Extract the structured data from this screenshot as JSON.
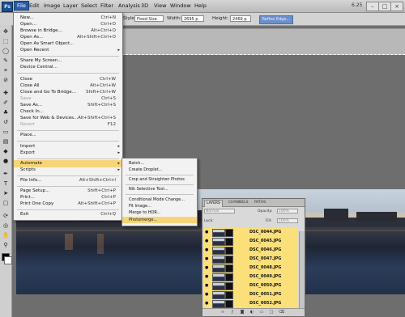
{
  "menubar": {
    "logo": "Ps",
    "items": [
      "File",
      "Edit",
      "Image",
      "Layer",
      "Select",
      "Filter",
      "Analysis",
      "3D",
      "View",
      "Window",
      "Help"
    ],
    "zoom": "6.25",
    "win_min": "–",
    "win_max": "□",
    "win_close": "×"
  },
  "options": {
    "style_label": "Style:",
    "style_value": "Fixed Size",
    "width_label": "Width:",
    "width_value": "2695 p",
    "height_label": "Height:",
    "height_value": "2469 p",
    "refine": "Refine Edge..."
  },
  "file_menu": [
    {
      "label": "New...",
      "shortcut": "Ctrl+N"
    },
    {
      "label": "Open...",
      "shortcut": "Ctrl+O"
    },
    {
      "label": "Browse in Bridge...",
      "shortcut": "Alt+Ctrl+O"
    },
    {
      "label": "Open As...",
      "shortcut": "Alt+Shift+Ctrl+O"
    },
    {
      "label": "Open As Smart Object...",
      "shortcut": ""
    },
    {
      "label": "Open Recent",
      "shortcut": "",
      "arrow": "▸"
    },
    {
      "label": "Share My Screen...",
      "shortcut": ""
    },
    {
      "label": "Device Central...",
      "shortcut": ""
    },
    {
      "label": "Close",
      "shortcut": "Ctrl+W"
    },
    {
      "label": "Close All",
      "shortcut": "Alt+Ctrl+W"
    },
    {
      "label": "Close and Go To Bridge...",
      "shortcut": "Shift+Ctrl+W"
    },
    {
      "label": "Save",
      "shortcut": "Ctrl+S",
      "disabled": true
    },
    {
      "label": "Save As...",
      "shortcut": "Shift+Ctrl+S"
    },
    {
      "label": "Check In...",
      "shortcut": ""
    },
    {
      "label": "Save for Web & Devices...",
      "shortcut": "Alt+Shift+Ctrl+S"
    },
    {
      "label": "Revert",
      "shortcut": "F12",
      "disabled": true
    },
    {
      "label": "Place...",
      "shortcut": ""
    },
    {
      "label": "Import",
      "shortcut": "",
      "arrow": "▸"
    },
    {
      "label": "Export",
      "shortcut": "",
      "arrow": "▸"
    },
    {
      "label": "Automate",
      "shortcut": "",
      "arrow": "▸",
      "highlight": true
    },
    {
      "label": "Scripts",
      "shortcut": "",
      "arrow": "▸"
    },
    {
      "label": "File Info...",
      "shortcut": "Alt+Shift+Ctrl+I"
    },
    {
      "label": "Page Setup...",
      "shortcut": "Shift+Ctrl+P"
    },
    {
      "label": "Print...",
      "shortcut": "Ctrl+P"
    },
    {
      "label": "Print One Copy",
      "shortcut": "Alt+Shift+Ctrl+P"
    },
    {
      "label": "Exit",
      "shortcut": "Ctrl+Q"
    }
  ],
  "automate_menu": [
    {
      "label": "Batch..."
    },
    {
      "label": "Create Droplet..."
    },
    {
      "label": "Crop and Straighten Photos"
    },
    {
      "label": "Nik Selective Tool..."
    },
    {
      "label": "Conditional Mode Change..."
    },
    {
      "label": "Fit Image..."
    },
    {
      "label": "Merge to HDR..."
    },
    {
      "label": "Photomerge...",
      "highlight": true
    }
  ],
  "layers_panel": {
    "tabs": [
      "LAYERS",
      "CHANNELS",
      "PATHS"
    ],
    "blend_mode": "Normal",
    "opacity_label": "Opacity:",
    "opacity_value": "100%",
    "lock_label": "Lock:",
    "fill_label": "Fill:",
    "fill_value": "100%",
    "layers": [
      "DSC_0044.JPG",
      "DSC_0045.JPG",
      "DSC_0046.JPG",
      "DSC_0047.JPG",
      "DSC_0048.JPG",
      "DSC_0049.JPG",
      "DSC_0050.JPG",
      "DSC_0051.JPG",
      "DSC_0052.JPG"
    ],
    "bottom_icons": [
      "link-icon",
      "fx-icon",
      "mask-icon",
      "adjustment-icon",
      "folder-icon",
      "new-layer-icon",
      "trash-icon"
    ]
  },
  "colors": {
    "highlight": "#f6d57a",
    "menubar": "#c9c9c9",
    "accent": "#2a5ca8"
  }
}
